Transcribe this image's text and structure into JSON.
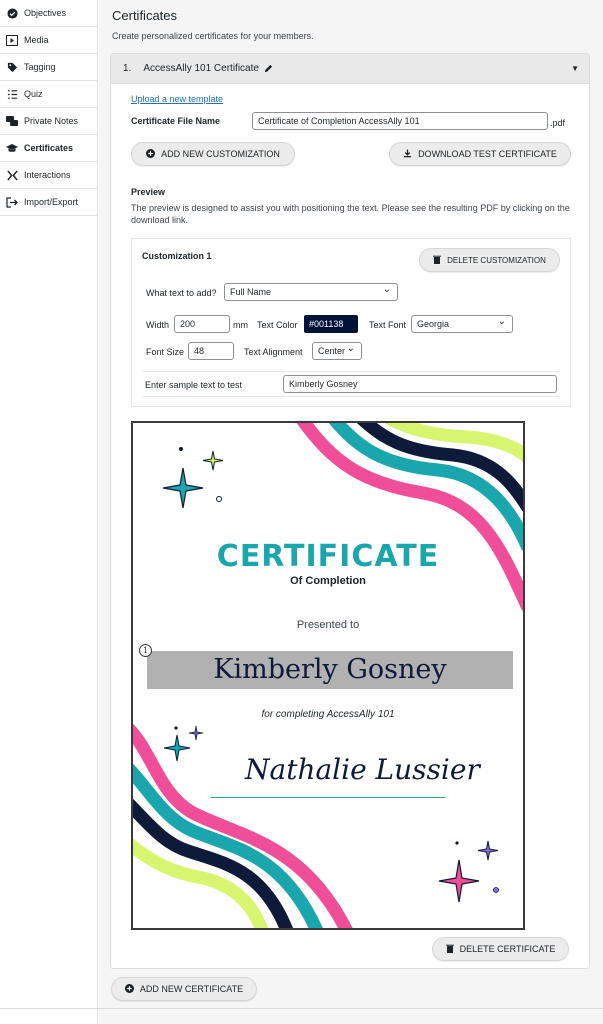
{
  "sidebar": {
    "items": [
      {
        "label": "Objectives",
        "icon": "check-circle-icon"
      },
      {
        "label": "Media",
        "icon": "play-icon"
      },
      {
        "label": "Tagging",
        "icon": "tag-icon"
      },
      {
        "label": "Quiz",
        "icon": "list-icon"
      },
      {
        "label": "Private Notes",
        "icon": "notes-icon"
      },
      {
        "label": "Certificates",
        "icon": "graduation-cap-icon"
      },
      {
        "label": "Interactions",
        "icon": "interactions-icon"
      },
      {
        "label": "Import/Export",
        "icon": "import-export-icon"
      }
    ],
    "active": "Certificates"
  },
  "page": {
    "title": "Certificates",
    "subtitle": "Create personalized certificates for your members."
  },
  "certificate": {
    "number": "1.",
    "name": "AccessAlly 101 Certificate",
    "upload_link": "Upload a new template",
    "file_name_label": "Certificate File Name",
    "file_name_value": "Certificate of Completion AccessAlly 101",
    "file_ext": ".pdf",
    "add_customization": "ADD NEW CUSTOMIZATION",
    "download_test": "DOWNLOAD TEST CERTIFICATE",
    "preview_label": "Preview",
    "preview_desc": "The preview is designed to assist you with positioning the text. Please see the resulting PDF by clicking on the download link.",
    "delete_certificate": "DELETE CERTIFICATE"
  },
  "customization": {
    "title": "Customization 1",
    "delete": "DELETE CUSTOMIZATION",
    "what_text_label": "What text to add?",
    "what_text_value": "Full Name",
    "width_label": "Width",
    "width_value": "200",
    "width_unit": "mm",
    "text_color_label": "Text Color",
    "text_color_value": "#001138",
    "text_font_label": "Text Font",
    "text_font_value": "Georgia",
    "font_size_label": "Font Size",
    "font_size_value": "48",
    "alignment_label": "Text Alignment",
    "alignment_value": "Center",
    "sample_label": "Enter sample text to test",
    "sample_value": "Kimberly Gosney"
  },
  "preview": {
    "heading": "CERTIFICATE",
    "subheading": "Of Completion",
    "presented": "Presented to",
    "name": "Kimberly Gosney",
    "marker": "1",
    "for_text": "for completing AccessAlly 101",
    "signature": "Nathalie Lussier"
  },
  "add_certificate": "ADD NEW CERTIFICATE",
  "colors": {
    "teal": "#1aa6ad",
    "pink": "#f04e98",
    "navy": "#0e1a3a",
    "lime": "#d7f56e"
  }
}
